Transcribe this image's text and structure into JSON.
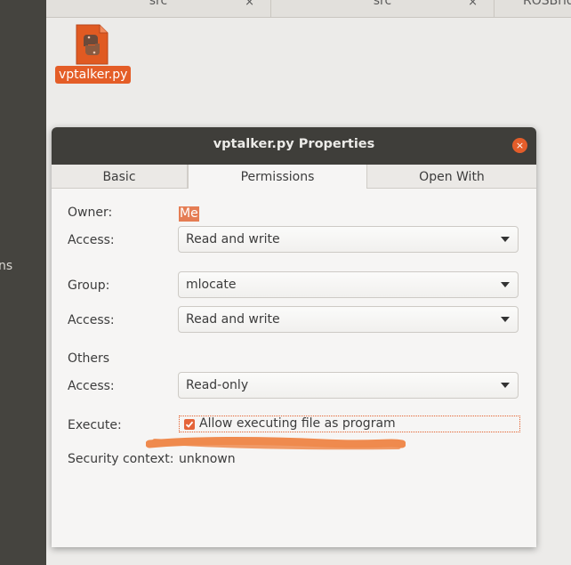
{
  "sidebar": {
    "partial_text": "ns"
  },
  "file_manager": {
    "tabs": [
      {
        "label": "src",
        "close": "×"
      },
      {
        "label": "src",
        "close": "×"
      },
      {
        "label": "ROSBrid"
      }
    ]
  },
  "desktop": {
    "file_label": "vptalker.py",
    "file_icon": "python-file-icon"
  },
  "dialog": {
    "title": "vptalker.py Properties",
    "close_glyph": "×",
    "tabs": [
      "Basic",
      "Permissions",
      "Open With"
    ],
    "active_tab": "Permissions",
    "owner_label": "Owner:",
    "owner_value": "Me",
    "owner_access_label": "Access:",
    "owner_access_value": "Read and write",
    "group_label": "Group:",
    "group_value": "mlocate",
    "group_access_label": "Access:",
    "group_access_value": "Read and write",
    "others_label": "Others",
    "others_access_label": "Access:",
    "others_access_value": "Read-only",
    "execute_label": "Execute:",
    "execute_checkbox_label": "Allow executing file as program",
    "execute_checked": true,
    "security_label": "Security context:",
    "security_value": "unknown"
  },
  "colors": {
    "accent": "#e45d27",
    "titlebar": "#3f3e3a",
    "sidebar": "#45443f",
    "annotation_stroke": "#ef8a4e"
  }
}
